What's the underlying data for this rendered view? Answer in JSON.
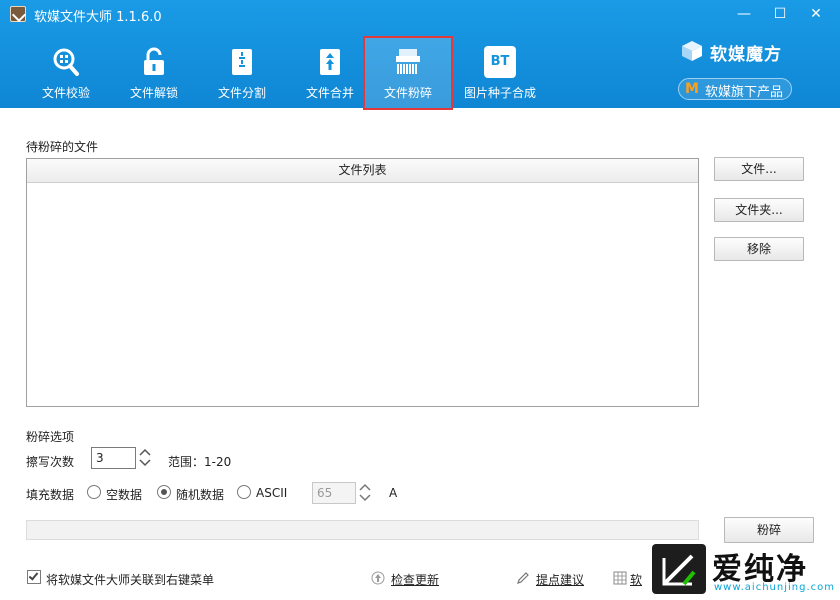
{
  "window": {
    "title": "软媒文件大师 1.1.6.0"
  },
  "window_controls": {
    "minimize": "—",
    "maximize": "☐",
    "close": "✕"
  },
  "toolbar": {
    "items": [
      {
        "label": "文件校验",
        "icon": "search-icon"
      },
      {
        "label": "文件解锁",
        "icon": "unlock-icon"
      },
      {
        "label": "文件分割",
        "icon": "file-split-icon"
      },
      {
        "label": "文件合并",
        "icon": "file-merge-icon"
      },
      {
        "label": "文件粉碎",
        "icon": "shredder-icon",
        "active": true
      },
      {
        "label": "图片种子合成",
        "icon": "bt-icon",
        "icon_text": "BT"
      }
    ]
  },
  "brand": {
    "name": "软媒魔方",
    "subproduct_label": "软媒旗下产品",
    "subproduct_mark": "M"
  },
  "shred": {
    "files_label": "待粉碎的文件",
    "file_list_header": "文件列表",
    "buttons": {
      "file": "文件...",
      "folder": "文件夹...",
      "remove": "移除",
      "shred": "粉碎"
    }
  },
  "options": {
    "title": "粉碎选项",
    "overwrite_label": "擦写次数",
    "overwrite_value": "3",
    "range_label": "范围：1-20",
    "fill_label": "填充数据",
    "fill_options": [
      {
        "label": "空数据",
        "selected": false
      },
      {
        "label": "随机数据",
        "selected": true
      },
      {
        "label": "ASCII",
        "selected": false
      }
    ],
    "ascii_value": "65",
    "ascii_char": "A"
  },
  "progress": {
    "fraction": 0
  },
  "footer": {
    "context_menu_label": "将软媒文件大师关联到右键菜单",
    "context_menu_checked": true,
    "check_update": "检查更新",
    "feedback": "提点建议",
    "more_partial": "软"
  },
  "watermark": {
    "text": "爱纯净",
    "url": "www.aichunjing.com"
  },
  "colors": {
    "header_blue": "#1a9be6",
    "active_outline": "#e5383b",
    "brand_orange": "#ff9f1a"
  }
}
